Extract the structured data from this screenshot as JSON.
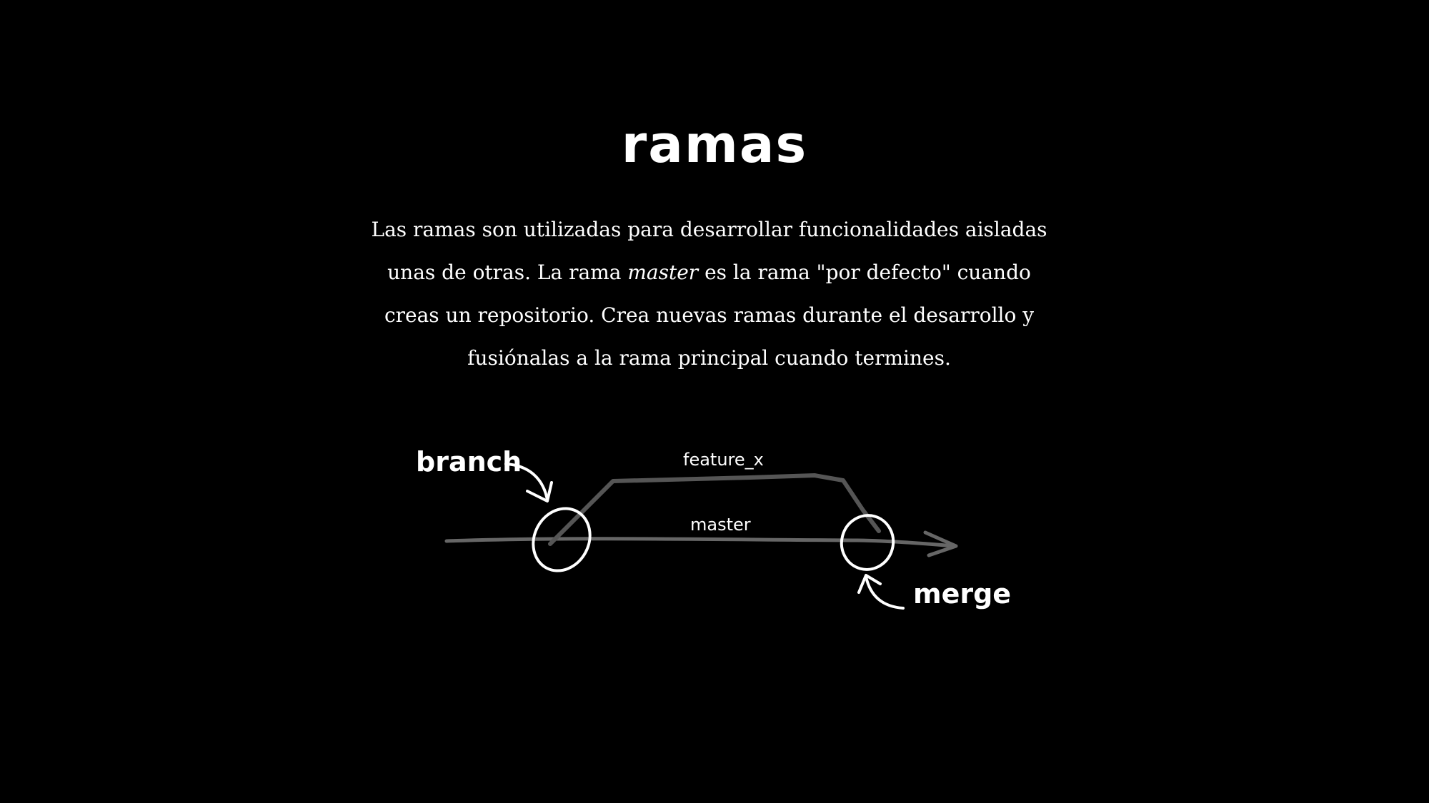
{
  "title": "ramas",
  "description": {
    "part1": "Las ramas son utilizadas para desarrollar funcionalidades aisladas unas de otras. La rama ",
    "emphasis": "master",
    "part2": " es la rama \"por defecto\" cuando creas un repositorio. Crea nuevas ramas durante el desarrollo y fusiónalas a la rama principal cuando termines."
  },
  "diagram": {
    "label_branch": "branch",
    "label_merge": "merge",
    "label_feature": "feature_x",
    "label_master": "master",
    "colors": {
      "background": "#000000",
      "text": "#ffffff",
      "line": "#666666",
      "ink": "#ffffff"
    }
  }
}
